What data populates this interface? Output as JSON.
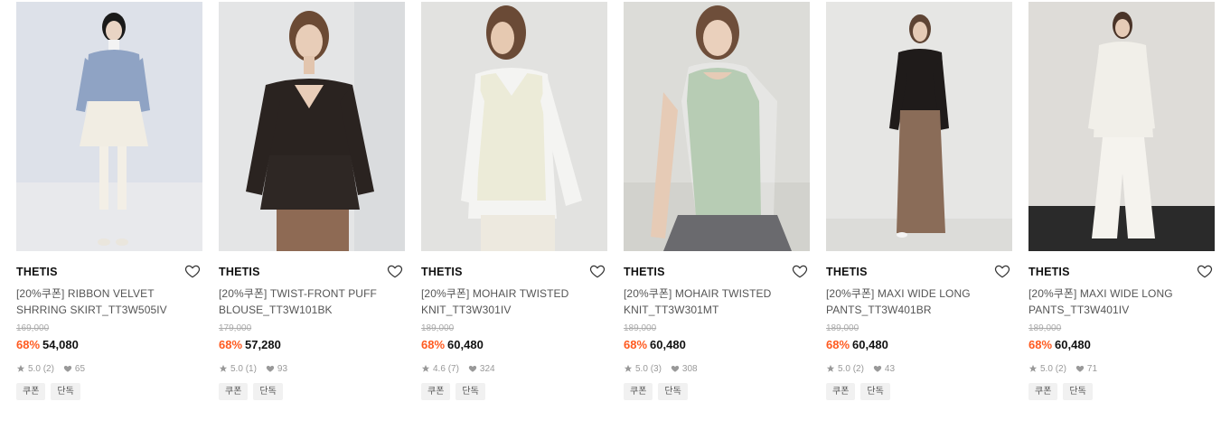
{
  "colors": {
    "discount": "#ff5a1f",
    "tag_bg": "#f1f1f1"
  },
  "products": [
    {
      "brand": "THETIS",
      "title_line1": "[20%쿠폰] RIBBON VELVET",
      "title_line2": "SHRRING SKIRT_TT3W505IV",
      "original_price": "169,000",
      "discount": "68%",
      "price": "54,080",
      "rating": "5.0",
      "review_count": "(2)",
      "likes": "65",
      "tags": [
        "쿠폰",
        "단독"
      ]
    },
    {
      "brand": "THETIS",
      "title_line1": "[20%쿠폰] TWIST-FRONT PUFF",
      "title_line2": "BLOUSE_TT3W101BK",
      "original_price": "179,000",
      "discount": "68%",
      "price": "57,280",
      "rating": "5.0",
      "review_count": "(1)",
      "likes": "93",
      "tags": [
        "쿠폰",
        "단독"
      ]
    },
    {
      "brand": "THETIS",
      "title_line1": "[20%쿠폰] MOHAIR TWISTED",
      "title_line2": "KNIT_TT3W301IV",
      "original_price": "189,000",
      "discount": "68%",
      "price": "60,480",
      "rating": "4.6",
      "review_count": "(7)",
      "likes": "324",
      "tags": [
        "쿠폰",
        "단독"
      ]
    },
    {
      "brand": "THETIS",
      "title_line1": "[20%쿠폰] MOHAIR TWISTED",
      "title_line2": "KNIT_TT3W301MT",
      "original_price": "189,000",
      "discount": "68%",
      "price": "60,480",
      "rating": "5.0",
      "review_count": "(3)",
      "likes": "308",
      "tags": [
        "쿠폰",
        "단독"
      ]
    },
    {
      "brand": "THETIS",
      "title_line1": "[20%쿠폰] MAXI WIDE LONG",
      "title_line2": "PANTS_TT3W401BR",
      "original_price": "189,000",
      "discount": "68%",
      "price": "60,480",
      "rating": "5.0",
      "review_count": "(2)",
      "likes": "43",
      "tags": [
        "쿠폰",
        "단독"
      ]
    },
    {
      "brand": "THETIS",
      "title_line1": "[20%쿠폰] MAXI WIDE LONG",
      "title_line2": "PANTS_TT3W401IV",
      "original_price": "189,000",
      "discount": "68%",
      "price": "60,480",
      "rating": "5.0",
      "review_count": "(2)",
      "likes": "71",
      "tags": [
        "쿠폰",
        "단독"
      ]
    }
  ]
}
